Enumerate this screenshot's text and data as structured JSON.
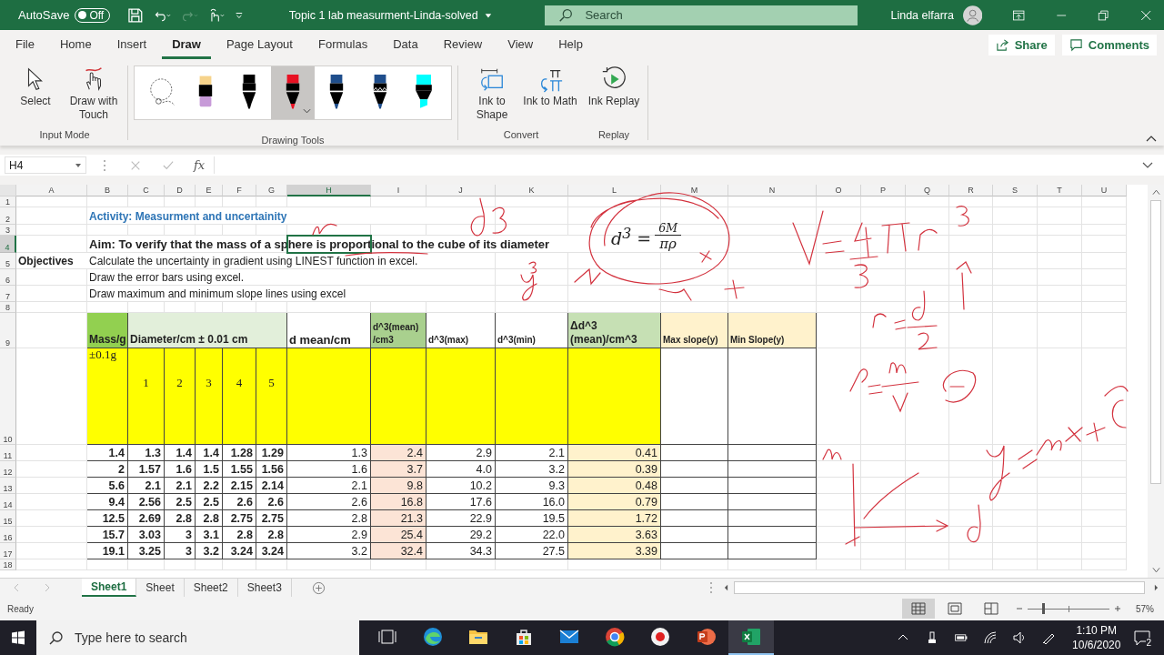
{
  "title_bar": {
    "autosave_label": "AutoSave",
    "autosave": {
      "on": false,
      "label": "Off"
    },
    "redo_disabled": true,
    "document_title": "Topic 1 lab measurment-Linda-solved",
    "search_placeholder": "Search",
    "user_name": "Linda elfarra"
  },
  "menu": [
    {
      "label": "File",
      "selected": false
    },
    {
      "label": "Home",
      "selected": false
    },
    {
      "label": "Insert",
      "selected": false
    },
    {
      "label": "Draw",
      "selected": true
    },
    {
      "label": "Page Layout",
      "selected": false
    },
    {
      "label": "Formulas",
      "selected": false
    },
    {
      "label": "Data",
      "selected": false
    },
    {
      "label": "Review",
      "selected": false
    },
    {
      "label": "View",
      "selected": false
    },
    {
      "label": "Help",
      "selected": false
    }
  ],
  "share_label": "Share",
  "comments_label": "Comments",
  "ribbon": {
    "input_mode": {
      "label": "Input Mode",
      "buttons": [
        {
          "kind": "select",
          "label": "Select"
        },
        {
          "kind": "touch",
          "label": "Draw with Touch"
        }
      ]
    },
    "drawing_tools": {
      "label": "Drawing Tools",
      "tools": [
        {
          "kind": "lasso",
          "selected": false
        },
        {
          "kind": "eraser",
          "selected": false
        },
        {
          "kind": "pen",
          "color": "#000000",
          "selected": false
        },
        {
          "kind": "pen",
          "color": "#e81123",
          "selected": true
        },
        {
          "kind": "pen",
          "color": "#1f4e8c",
          "selected": false
        },
        {
          "kind": "pencil",
          "color": "#1f4e8c",
          "selected": false
        },
        {
          "kind": "highlighter",
          "color": "#00ffff",
          "selected": false
        }
      ]
    },
    "convert": {
      "label": "Convert",
      "buttons": [
        {
          "kind": "shape",
          "label": "Ink to Shape"
        },
        {
          "kind": "math",
          "label": "Ink to Math"
        }
      ]
    },
    "replay": {
      "label": "Replay",
      "buttons": [
        {
          "kind": "replay",
          "label": "Ink Replay"
        }
      ]
    }
  },
  "formula_bar": {
    "name_box": "H4",
    "fx": "fx"
  },
  "sheet": {
    "columns": [
      {
        "label": "A",
        "selected": false
      },
      {
        "label": "B",
        "selected": false
      },
      {
        "label": "C",
        "selected": false
      },
      {
        "label": "D",
        "selected": false
      },
      {
        "label": "E",
        "selected": false
      },
      {
        "label": "F",
        "selected": false
      },
      {
        "label": "G",
        "selected": false
      },
      {
        "label": "H",
        "selected": true
      },
      {
        "label": "I",
        "selected": false
      },
      {
        "label": "J",
        "selected": false
      },
      {
        "label": "K",
        "selected": false
      },
      {
        "label": "L",
        "selected": false
      },
      {
        "label": "M",
        "selected": false
      },
      {
        "label": "N",
        "selected": false
      },
      {
        "label": "O",
        "selected": false
      },
      {
        "label": "P",
        "selected": false
      },
      {
        "label": "Q",
        "selected": false
      },
      {
        "label": "R",
        "selected": false
      },
      {
        "label": "S",
        "selected": false
      },
      {
        "label": "T",
        "selected": false
      },
      {
        "label": "U",
        "selected": false
      }
    ],
    "rows": [
      {
        "label": "1",
        "selected": false
      },
      {
        "label": "2",
        "selected": false
      },
      {
        "label": "3",
        "selected": false
      },
      {
        "label": "4",
        "selected": true
      },
      {
        "label": "5",
        "selected": false
      },
      {
        "label": "6",
        "selected": false
      },
      {
        "label": "7",
        "selected": false
      },
      {
        "label": "8",
        "selected": false
      },
      {
        "label": "9",
        "selected": false
      },
      {
        "label": "10",
        "selected": false
      },
      {
        "label": "11",
        "selected": false
      },
      {
        "label": "12",
        "selected": false
      },
      {
        "label": "13",
        "selected": false
      },
      {
        "label": "14",
        "selected": false
      },
      {
        "label": "15",
        "selected": false
      },
      {
        "label": "16",
        "selected": false
      },
      {
        "label": "17",
        "selected": false
      },
      {
        "label": "18",
        "selected": false
      }
    ],
    "title": "Activity: Measurment and uncertainity",
    "aim": "Aim: To verify that the mass of a sphere is proportional to the cube of its diameter",
    "objectives_label": "Objectives",
    "objectives": [
      "Calculate the uncertainty in gradient using LINEST function in excel.",
      "Draw the error bars using excel.",
      "Draw maximum and minimum slope lines using excel"
    ],
    "headers": [
      {
        "text": "Mass/g",
        "color": "#92d050"
      },
      {
        "text": "Diameter/cm ± 0.01 cm",
        "color": "#e2efda"
      },
      {
        "text": "d mean/cm",
        "color": "#ffffff"
      },
      {
        "text": "d^3(mean) /cm3",
        "color": "#a9d08e"
      },
      {
        "text": "d^3(max)",
        "color": "#ffffff"
      },
      {
        "text": "d^3(min)",
        "color": "#ffffff"
      },
      {
        "text": "Δd^3 (mean)/cm^3",
        "color": "#c6e0b4"
      },
      {
        "text": "Max slope(y)",
        "color": "#fff2cc"
      },
      {
        "text": "Min Slope(y)",
        "color": "#fff2cc"
      }
    ],
    "mass_uncertainty": "±0.1g",
    "trial_labels": [
      "1",
      "2",
      "3",
      "4",
      "5"
    ],
    "data": [
      {
        "mass": "1.4",
        "diameters": [
          "1.3",
          "1.4",
          "1.4",
          "1.28",
          "1.29"
        ],
        "mean": "1.3",
        "d3_mean": "2.4",
        "d3_max": "2.9",
        "d3_min": "2.1",
        "delta": "0.41"
      },
      {
        "mass": "2",
        "diameters": [
          "1.57",
          "1.6",
          "1.5",
          "1.55",
          "1.56"
        ],
        "mean": "1.6",
        "d3_mean": "3.7",
        "d3_max": "4.0",
        "d3_min": "3.2",
        "delta": "0.39"
      },
      {
        "mass": "5.6",
        "diameters": [
          "2.1",
          "2.1",
          "2.2",
          "2.15",
          "2.14"
        ],
        "mean": "2.1",
        "d3_mean": "9.8",
        "d3_max": "10.2",
        "d3_min": "9.3",
        "delta": "0.48"
      },
      {
        "mass": "9.4",
        "diameters": [
          "2.56",
          "2.5",
          "2.5",
          "2.6",
          "2.6"
        ],
        "mean": "2.6",
        "d3_mean": "16.8",
        "d3_max": "17.6",
        "d3_min": "16.0",
        "delta": "0.79"
      },
      {
        "mass": "12.5",
        "diameters": [
          "2.69",
          "2.8",
          "2.8",
          "2.75",
          "2.75"
        ],
        "mean": "2.8",
        "d3_mean": "21.3",
        "d3_max": "22.9",
        "d3_min": "19.5",
        "delta": "1.72"
      },
      {
        "mass": "15.7",
        "diameters": [
          "3.03",
          "3",
          "3.1",
          "2.8",
          "2.8"
        ],
        "mean": "2.9",
        "d3_mean": "25.4",
        "d3_max": "29.2",
        "d3_min": "22.0",
        "delta": "3.63"
      },
      {
        "mass": "19.1",
        "diameters": [
          "3.25",
          "3",
          "3.2",
          "3.24",
          "3.24"
        ],
        "mean": "3.2",
        "d3_mean": "32.4",
        "d3_max": "34.3",
        "d3_min": "27.5",
        "delta": "3.39"
      }
    ],
    "equation": {
      "lhs": "d$^{3}$ =",
      "numerator": "6M",
      "denominator": "πρ"
    }
  },
  "sheet_tabs": [
    {
      "label": "Sheet1",
      "selected": true
    },
    {
      "label": "Sheet",
      "selected": false
    },
    {
      "label": "Sheet2",
      "selected": false
    },
    {
      "label": "Sheet3",
      "selected": false
    }
  ],
  "status_bar": {
    "status": "Ready",
    "views": [
      {
        "kind": "normal",
        "selected": true
      },
      {
        "kind": "page-layout",
        "selected": false
      },
      {
        "kind": "page-break",
        "selected": false
      }
    ],
    "zoom": {
      "level": 0.19
    },
    "zoom_label": "57%"
  },
  "taskbar": {
    "search_placeholder": "Type here to search",
    "apps": [
      {
        "kind": "task-view",
        "selected": false
      },
      {
        "kind": "browser",
        "selected": false
      },
      {
        "kind": "folder",
        "selected": false
      },
      {
        "kind": "store",
        "selected": false
      },
      {
        "kind": "mail",
        "selected": false
      },
      {
        "kind": "chrome",
        "selected": false
      },
      {
        "kind": "record",
        "selected": false
      },
      {
        "kind": "slides",
        "selected": false
      },
      {
        "kind": "spreadsheet",
        "selected": true
      }
    ],
    "time": "1:10 PM",
    "date": "10/6/2020",
    "notifications": "2"
  }
}
